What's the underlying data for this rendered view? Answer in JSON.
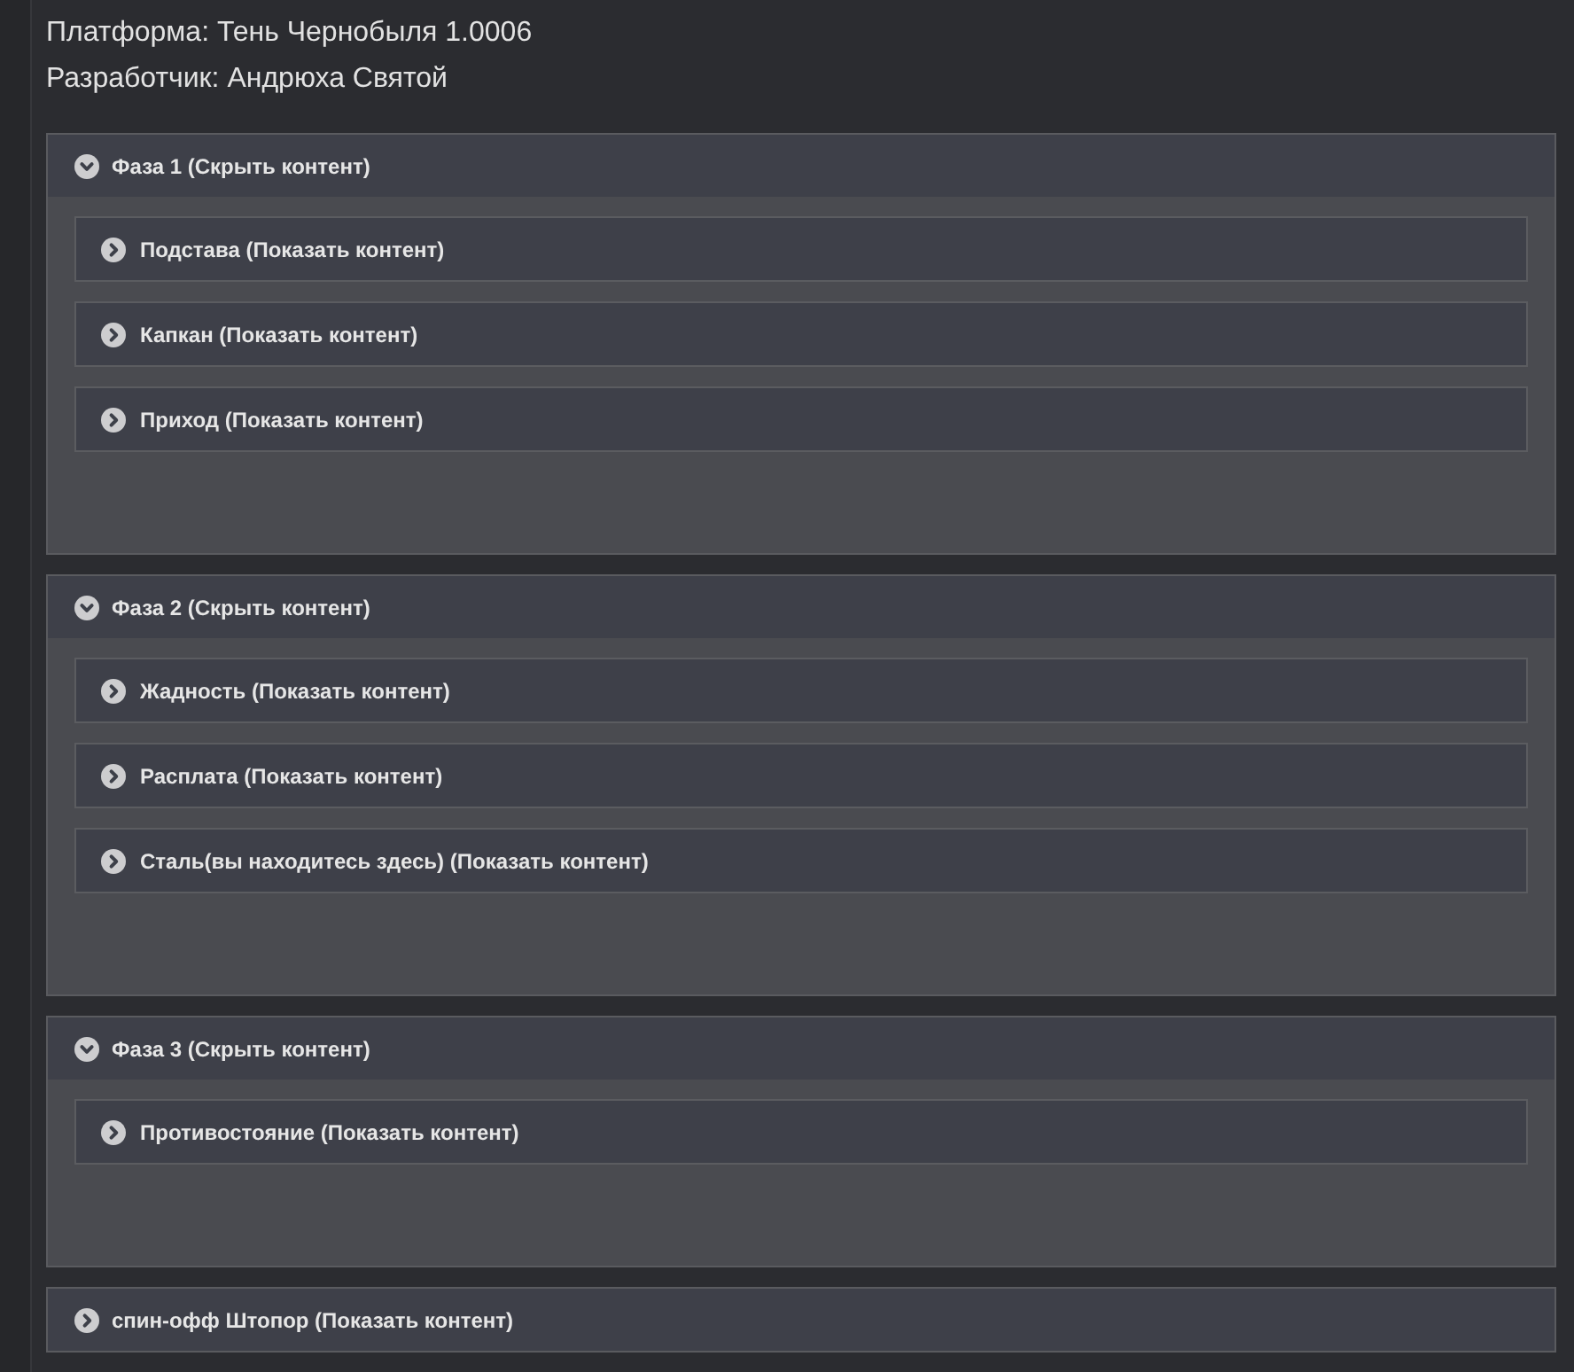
{
  "info_lines": [
    "Платформа: Тень Чернобыля 1.0006",
    "Разработчик: Андрюха Святой"
  ],
  "sections": [
    {
      "title": "Фаза 1 (Скрыть контент)",
      "expanded": true,
      "children": [
        {
          "title": "Подстава (Показать контент)",
          "expanded": false
        },
        {
          "title": "Капкан (Показать контент)",
          "expanded": false
        },
        {
          "title": "Приход (Показать контент)",
          "expanded": false
        }
      ]
    },
    {
      "title": "Фаза 2 (Скрыть контент)",
      "expanded": true,
      "children": [
        {
          "title": "Жадность (Показать контент)",
          "expanded": false
        },
        {
          "title": "Расплата (Показать контент)",
          "expanded": false
        },
        {
          "title": "Сталь(вы находитесь здесь) (Показать контент)",
          "expanded": false
        }
      ]
    },
    {
      "title": "Фаза 3 (Скрыть контент)",
      "expanded": true,
      "children": [
        {
          "title": "Противостояние (Показать контент)",
          "expanded": false
        }
      ]
    },
    {
      "title": "спин-офф Штопор (Показать контент)",
      "expanded": false
    }
  ]
}
